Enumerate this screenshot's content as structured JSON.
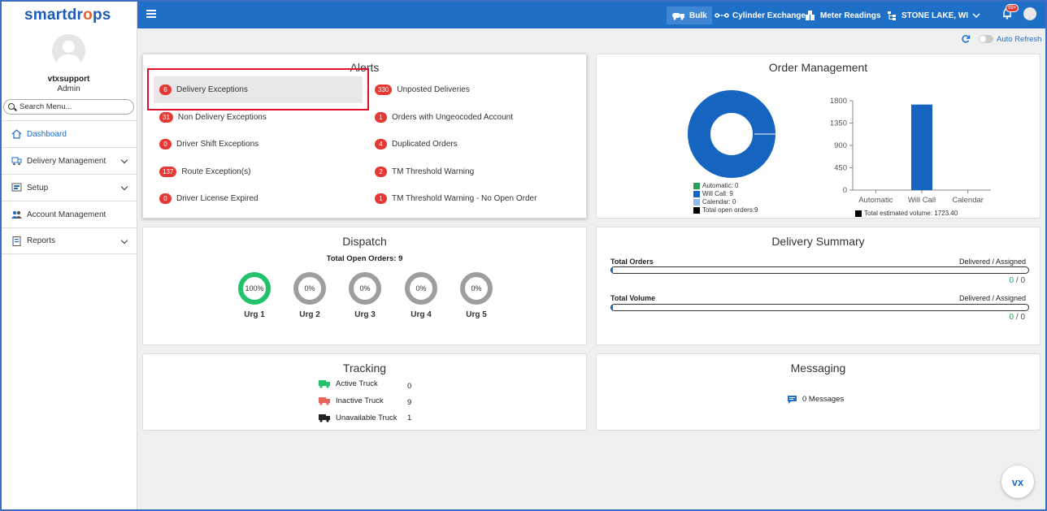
{
  "app": {
    "logo_text_a": "smartdr",
    "logo_text_b": "ps",
    "logo_o": "o"
  },
  "user": {
    "name": "vtxsupport",
    "role": "Admin"
  },
  "search": {
    "placeholder": "Search Menu..."
  },
  "sidebar": {
    "items": [
      {
        "label": "Dashboard",
        "active": true,
        "icon": "home-icon"
      },
      {
        "label": "Delivery Management",
        "icon": "truck-icon"
      },
      {
        "label": "Setup",
        "icon": "setup-icon"
      },
      {
        "label": "Account Management",
        "icon": "users-icon"
      },
      {
        "label": "Reports",
        "icon": "report-icon"
      }
    ]
  },
  "topbar": {
    "bulk": "Bulk",
    "cylinder": "Cylinder Exchange",
    "meter": "Meter Readings",
    "location": "STONE LAKE, WI",
    "notifications": "99+"
  },
  "refresh": {
    "label": "Auto Refresh"
  },
  "alerts": {
    "title": "Alerts",
    "left": [
      {
        "count": "6",
        "label": "Delivery Exceptions"
      },
      {
        "count": "31",
        "label": "Non Delivery Exceptions"
      },
      {
        "count": "0",
        "label": "Driver Shift Exceptions"
      },
      {
        "count": "137",
        "label": "Route Exception(s)"
      },
      {
        "count": "0",
        "label": "Driver License Expired"
      }
    ],
    "right": [
      {
        "count": "330",
        "label": "Unposted Deliveries"
      },
      {
        "count": "1",
        "label": "Orders with Ungeocoded Account"
      },
      {
        "count": "4",
        "label": "Duplicated Orders"
      },
      {
        "count": "2",
        "label": "TM Threshold Warning"
      },
      {
        "count": "1",
        "label": "TM Threshold Warning - No Open Order"
      }
    ]
  },
  "order_mgmt": {
    "title": "Order Management",
    "legend": [
      "Automatic: 0",
      "Will Call: 9",
      "Calendar: 0",
      "Total open orders:9"
    ],
    "volume_label": "Total estimated volume: 1723.40",
    "colors": {
      "automatic": "#2e9e5b",
      "will_call": "#1565c0",
      "calendar": "#90b8e8",
      "total": "#000000"
    }
  },
  "chart_data": {
    "type": "bar",
    "categories": [
      "Automatic",
      "Will Call",
      "Calendar"
    ],
    "values": [
      0,
      1723.4,
      0
    ],
    "yticks": [
      "0",
      "450",
      "900",
      "1350",
      "1800"
    ],
    "ylim": [
      0,
      1800
    ],
    "color": "#1565c0"
  },
  "dispatch": {
    "title": "Dispatch",
    "total": "Total Open Orders: 9",
    "rings": [
      {
        "value": "100%",
        "label": "Urg 1",
        "pct": 1.0
      },
      {
        "value": "0%",
        "label": "Urg 2",
        "pct": 0
      },
      {
        "value": "0%",
        "label": "Urg 3",
        "pct": 0
      },
      {
        "value": "0%",
        "label": "Urg 4",
        "pct": 0
      },
      {
        "value": "0%",
        "label": "Urg 5",
        "pct": 0
      }
    ]
  },
  "delivery_summary": {
    "title": "Delivery Summary",
    "rows": [
      {
        "label": "Total Orders",
        "right": "Delivered / Assigned",
        "delivered": "0",
        "sep": "/",
        "assigned": "0"
      },
      {
        "label": "Total Volume",
        "right": "Delivered / Assigned",
        "delivered": "0",
        "sep": "/",
        "assigned": "0"
      }
    ]
  },
  "tracking": {
    "title": "Tracking",
    "rows": [
      {
        "label": "Active Truck",
        "value": "0",
        "color": "#22c26b"
      },
      {
        "label": "Inactive Truck",
        "value": "9",
        "color": "#e8645a"
      },
      {
        "label": "Unavailable Truck",
        "value": "1",
        "color": "#222222"
      }
    ]
  },
  "messaging": {
    "title": "Messaging",
    "label": "0 Messages"
  },
  "help": {
    "label": "vx"
  }
}
